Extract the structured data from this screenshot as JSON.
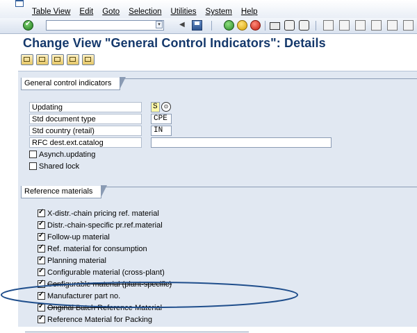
{
  "menu": {
    "items": [
      "Table View",
      "Edit",
      "Goto",
      "Selection",
      "Utilities",
      "System",
      "Help"
    ]
  },
  "toolbar": {
    "command_field_value": ""
  },
  "page": {
    "title": "Change View \"General Control Indicators\": Details"
  },
  "general": {
    "section_title": "General control indicators",
    "fields": [
      {
        "label": "Updating",
        "value": "S"
      },
      {
        "label": "Std document type",
        "value": "CPE"
      },
      {
        "label": "Std country (retail)",
        "value": "IN"
      },
      {
        "label": "RFC dest.ext.catalog",
        "value": ""
      }
    ],
    "checkboxes": [
      {
        "label": "Asynch.updating",
        "checked": false
      },
      {
        "label": "Shared lock",
        "checked": false
      }
    ]
  },
  "reference": {
    "section_title": "Reference materials",
    "items": [
      {
        "label": "X-distr.-chain pricing ref. material",
        "checked": true
      },
      {
        "label": "Distr.-chain-specific pr.ref.material",
        "checked": true
      },
      {
        "label": "Follow-up material",
        "checked": true
      },
      {
        "label": "Ref. material for consumption",
        "checked": true
      },
      {
        "label": "Planning material",
        "checked": true
      },
      {
        "label": "Configurable material (cross-plant)",
        "checked": true
      },
      {
        "label": "Configurable material (plant-specific)",
        "checked": true
      },
      {
        "label": "Manufacturer part no.",
        "checked": true
      },
      {
        "label": "Original Batch Reference Material",
        "checked": true
      },
      {
        "label": "Reference Material for Packing",
        "checked": true
      }
    ]
  },
  "annotation": {
    "color": "#1f4e8c"
  },
  "colors": {
    "title": "#14386b",
    "workspace": "#e1e8f2",
    "required_field": "#fff8a8"
  }
}
